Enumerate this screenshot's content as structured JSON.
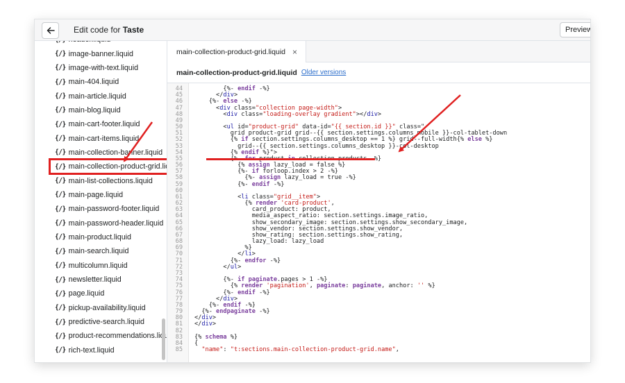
{
  "topbar": {
    "title_prefix": "Edit code for ",
    "store_name": "Taste",
    "preview_label": "Preview"
  },
  "sidebar": {
    "files": [
      "header.liquid",
      "image-banner.liquid",
      "image-with-text.liquid",
      "main-404.liquid",
      "main-article.liquid",
      "main-blog.liquid",
      "main-cart-footer.liquid",
      "main-cart-items.liquid",
      "main-collection-banner.liquid",
      "main-collection-product-grid.liquid",
      "main-list-collections.liquid",
      "main-page.liquid",
      "main-password-footer.liquid",
      "main-password-header.liquid",
      "main-product.liquid",
      "main-search.liquid",
      "multicolumn.liquid",
      "newsletter.liquid",
      "page.liquid",
      "pickup-availability.liquid",
      "predictive-search.liquid",
      "product-recommendations.liquid",
      "rich-text.liquid"
    ],
    "highlighted_index": 9,
    "file_icon": "{/}"
  },
  "tab": {
    "label": "main-collection-product-grid.liquid",
    "close_glyph": "×"
  },
  "filebar": {
    "filename": "main-collection-product-grid.liquid",
    "older_versions": "Older versions"
  },
  "code": [
    {
      "n": "44",
      "t": "        {%- endif -%}"
    },
    {
      "n": "45",
      "t": "      </div>"
    },
    {
      "n": "46",
      "t": "    {%- else -%}"
    },
    {
      "n": "47",
      "t": "      <div class=\"collection page-width\">"
    },
    {
      "n": "48",
      "t": "        <div class=\"loading-overlay gradient\"></div>"
    },
    {
      "n": "49",
      "t": ""
    },
    {
      "n": "50",
      "t": "        <ul id=\"product-grid\" data-id=\"{{ section.id }}\" class=\""
    },
    {
      "n": "51",
      "t": "          grid product-grid grid--{{ section.settings.columns_mobile }}-col-tablet-down"
    },
    {
      "n": "52",
      "t": "          {% if section.settings.columns_desktop == 1 %} grid--full-width{% else %}"
    },
    {
      "n": "53",
      "t": "            grid--{{ section.settings.columns_desktop }}-col-desktop"
    },
    {
      "n": "54",
      "t": "          {% endif %}\">"
    },
    {
      "n": "55",
      "t": "          {%- for product in collection.products -%}"
    },
    {
      "n": "56",
      "t": "            {% assign lazy_load = false %}"
    },
    {
      "n": "57",
      "t": "            {%- if forloop.index > 2 -%}"
    },
    {
      "n": "58",
      "t": "              {%- assign lazy_load = true -%}"
    },
    {
      "n": "59",
      "t": "            {%- endif -%}"
    },
    {
      "n": "60",
      "t": ""
    },
    {
      "n": "61",
      "t": "            <li class=\"grid__item\">"
    },
    {
      "n": "62",
      "t": "              {% render 'card-product',"
    },
    {
      "n": "63",
      "t": "                card_product: product,"
    },
    {
      "n": "64",
      "t": "                media_aspect_ratio: section.settings.image_ratio,"
    },
    {
      "n": "65",
      "t": "                show_secondary_image: section.settings.show_secondary_image,"
    },
    {
      "n": "66",
      "t": "                show_vendor: section.settings.show_vendor,"
    },
    {
      "n": "67",
      "t": "                show_rating: section.settings.show_rating,"
    },
    {
      "n": "68",
      "t": "                lazy_load: lazy_load"
    },
    {
      "n": "69",
      "t": "              %}"
    },
    {
      "n": "70",
      "t": "            </li>"
    },
    {
      "n": "71",
      "t": "          {%- endfor -%}"
    },
    {
      "n": "72",
      "t": "        </ul>"
    },
    {
      "n": "73",
      "t": ""
    },
    {
      "n": "74",
      "t": "        {%- if paginate.pages > 1 -%}"
    },
    {
      "n": "75",
      "t": "          {% render 'pagination', paginate: paginate, anchor: '' %}"
    },
    {
      "n": "76",
      "t": "        {%- endif -%}"
    },
    {
      "n": "77",
      "t": "      </div>"
    },
    {
      "n": "78",
      "t": "    {%- endif -%}"
    },
    {
      "n": "79",
      "t": "  {%- endpaginate -%}"
    },
    {
      "n": "80",
      "t": "</div>"
    },
    {
      "n": "81",
      "t": "</div>"
    },
    {
      "n": "82",
      "t": ""
    },
    {
      "n": "83",
      "t": "{% schema %}"
    },
    {
      "n": "84",
      "t": "{"
    },
    {
      "n": "85",
      "t": "  \"name\": \"t:sections.main-collection-product-grid.name\","
    }
  ],
  "colors": {
    "highlight_red": "#e02020",
    "link_blue": "#2c6ecb"
  }
}
